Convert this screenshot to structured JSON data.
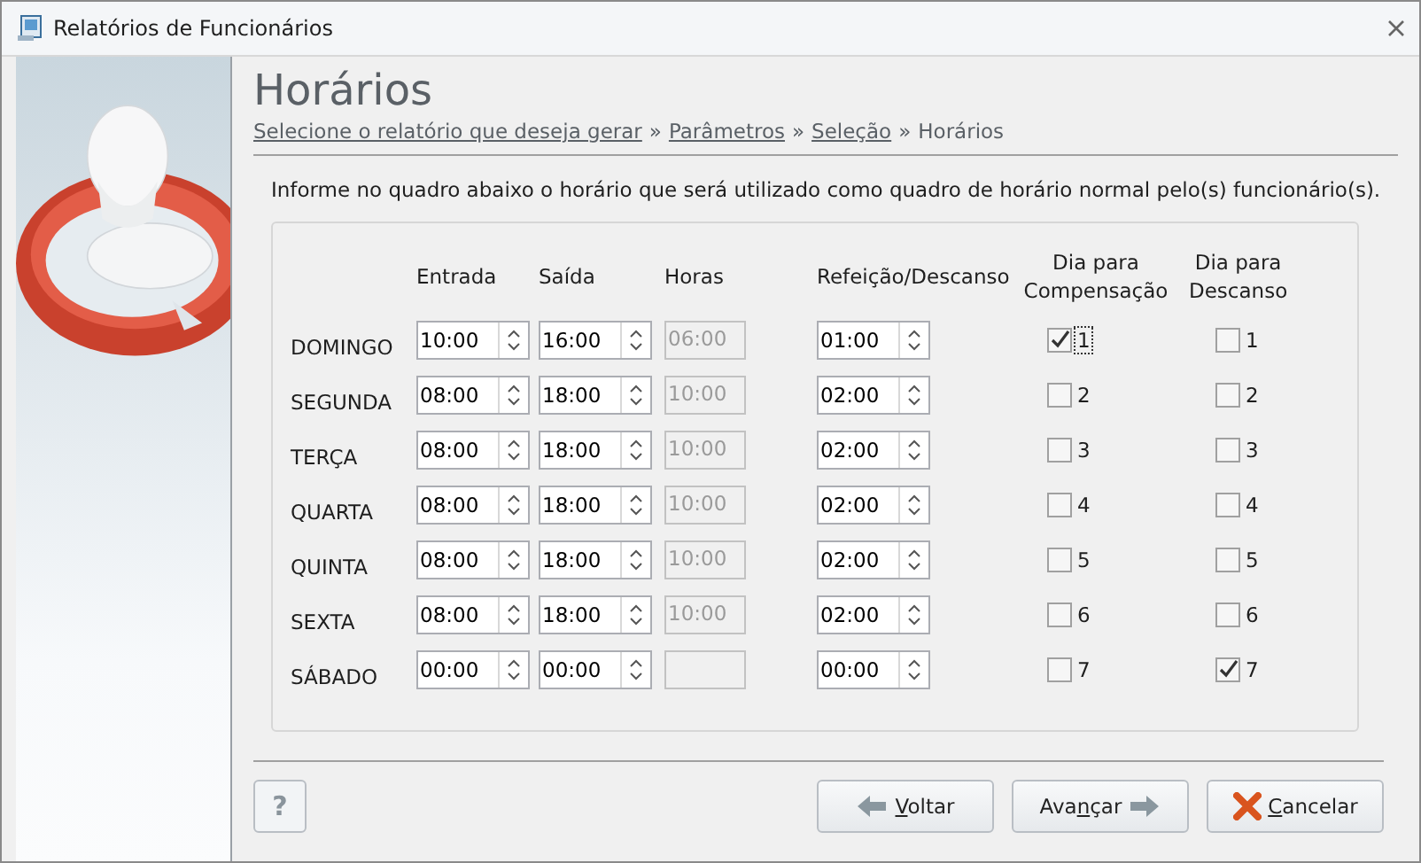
{
  "window": {
    "title": "Relatórios de Funcionários"
  },
  "page": {
    "title": "Horários"
  },
  "breadcrumb": [
    {
      "label": "Selecione o relatório que deseja gerar",
      "kind": "link"
    },
    {
      "label": "»",
      "kind": "separator"
    },
    {
      "label": "Parâmetros",
      "kind": "link"
    },
    {
      "label": "»",
      "kind": "separator"
    },
    {
      "label": "Seleção",
      "kind": "link"
    },
    {
      "label": "»",
      "kind": "separator"
    },
    {
      "label": "Horários",
      "kind": "current"
    }
  ],
  "instruction": "Informe no quadro abaixo o horário que será utilizado como quadro de horário normal pelo(s) funcionário(s).",
  "columns": {
    "entrada": "Entrada",
    "saida": "Saída",
    "horas": "Horas",
    "refeicao": "Refeição/Descanso",
    "compensacao": [
      "Dia para",
      "Compensação"
    ],
    "descanso": [
      "Dia para",
      "Descanso"
    ]
  },
  "rows": [
    {
      "day": "DOMINGO",
      "entrada": "10:00",
      "saida": "16:00",
      "horas": {
        "value": "06:00",
        "disabled": true
      },
      "refeicao": "01:00",
      "compensacao": {
        "label": "1",
        "checked": true,
        "focused": true
      },
      "descanso": {
        "label": "1",
        "checked": false,
        "focused": false
      }
    },
    {
      "day": "SEGUNDA",
      "entrada": "08:00",
      "saida": "18:00",
      "horas": {
        "value": "10:00",
        "disabled": true
      },
      "refeicao": "02:00",
      "compensacao": {
        "label": "2",
        "checked": false,
        "focused": false
      },
      "descanso": {
        "label": "2",
        "checked": false,
        "focused": false
      }
    },
    {
      "day": "TERÇA",
      "entrada": "08:00",
      "saida": "18:00",
      "horas": {
        "value": "10:00",
        "disabled": true
      },
      "refeicao": "02:00",
      "compensacao": {
        "label": "3",
        "checked": false,
        "focused": false
      },
      "descanso": {
        "label": "3",
        "checked": false,
        "focused": false
      }
    },
    {
      "day": "QUARTA",
      "entrada": "08:00",
      "saida": "18:00",
      "horas": {
        "value": "10:00",
        "disabled": true
      },
      "refeicao": "02:00",
      "compensacao": {
        "label": "4",
        "checked": false,
        "focused": false
      },
      "descanso": {
        "label": "4",
        "checked": false,
        "focused": false
      }
    },
    {
      "day": "QUINTA",
      "entrada": "08:00",
      "saida": "18:00",
      "horas": {
        "value": "10:00",
        "disabled": true
      },
      "refeicao": "02:00",
      "compensacao": {
        "label": "5",
        "checked": false,
        "focused": false
      },
      "descanso": {
        "label": "5",
        "checked": false,
        "focused": false
      }
    },
    {
      "day": "SEXTA",
      "entrada": "08:00",
      "saida": "18:00",
      "horas": {
        "value": "10:00",
        "disabled": true
      },
      "refeicao": "02:00",
      "compensacao": {
        "label": "6",
        "checked": false,
        "focused": false
      },
      "descanso": {
        "label": "6",
        "checked": false,
        "focused": false
      }
    },
    {
      "day": "SÁBADO",
      "entrada": "00:00",
      "saida": "00:00",
      "horas": {
        "disabled": true
      },
      "refeicao": "00:00",
      "compensacao": {
        "label": "7",
        "checked": false,
        "focused": false
      },
      "descanso": {
        "label": "7",
        "checked": true,
        "focused": false
      }
    }
  ],
  "footer": {
    "help": "?",
    "buttons": [
      {
        "kind": "back",
        "parts": [
          {
            "text": "V",
            "underline": true
          },
          {
            "text": "oltar",
            "underline": false
          }
        ]
      },
      {
        "kind": "next",
        "parts": [
          {
            "text": "Ava",
            "underline": false
          },
          {
            "text": "n",
            "underline": true
          },
          {
            "text": "çar",
            "underline": false
          }
        ]
      },
      {
        "kind": "cancel",
        "parts": [
          {
            "text": "C",
            "underline": true
          },
          {
            "text": "ancelar",
            "underline": false
          }
        ]
      }
    ]
  }
}
